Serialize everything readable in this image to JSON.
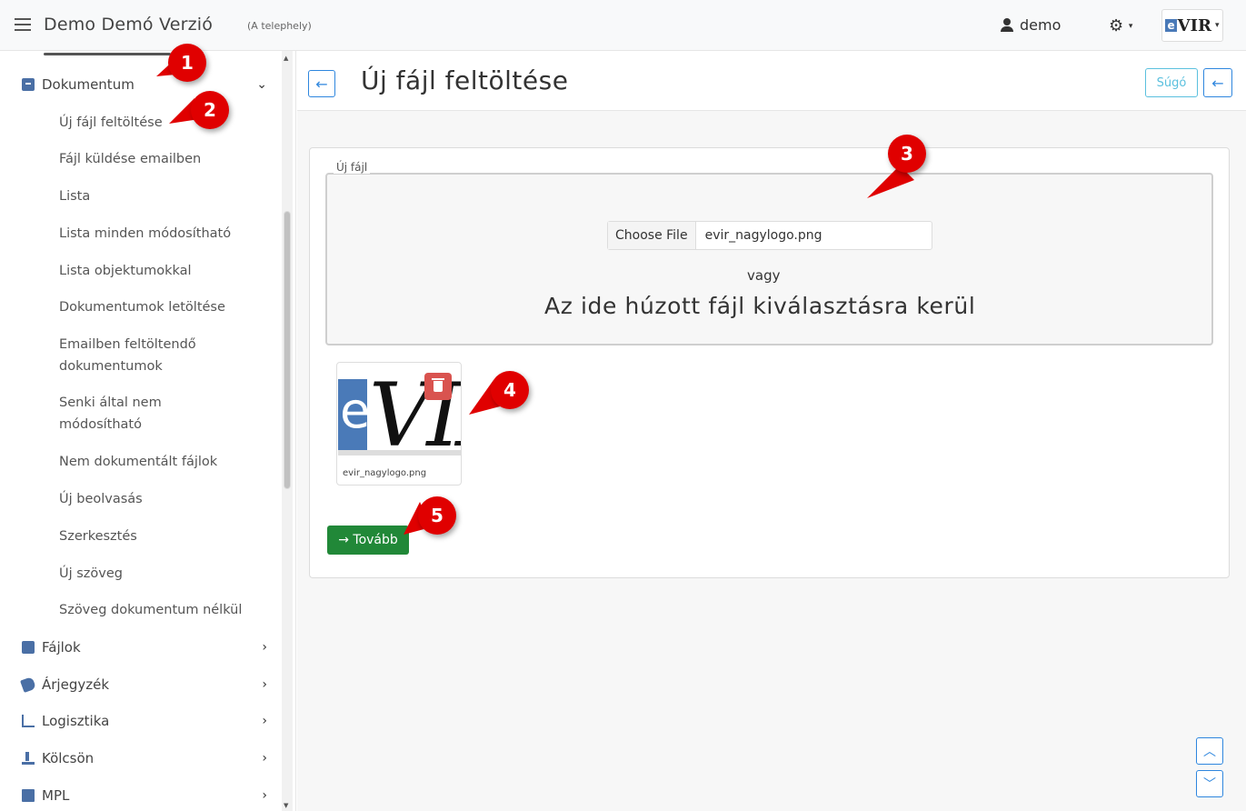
{
  "topbar": {
    "title": "Demo Demó Verzió",
    "subtitle": "(A telephely)",
    "user": "demo",
    "gear_icon": "gear-icon",
    "logo": "eVIR"
  },
  "sidebar": {
    "section": "Dokumentum",
    "sub_items": [
      "Új fájl feltöltése",
      "Fájl küldése emailben",
      "Lista",
      "Lista minden módosítható",
      "Lista objektumokkal",
      "Dokumentumok letöltése",
      "Emailben feltöltendő dokumentumok",
      "Senki által nem módosítható",
      "Nem dokumentált fájlok",
      "Új beolvasás",
      "Szerkesztés",
      "Új szöveg",
      "Szöveg dokumentum nélkül"
    ],
    "items": [
      "Fájlok",
      "Árjegyzék",
      "Logisztika",
      "Kölcsön",
      "MPL"
    ]
  },
  "header": {
    "title": "Új fájl feltöltése",
    "help": "Súgó"
  },
  "upload": {
    "legend": "Új fájl",
    "choose": "Choose File",
    "file_name": "evir_nagylogo.png",
    "or": "vagy",
    "drop": "Az ide húzott fájl kiválasztásra kerül",
    "thumb_name": "evir_nagylogo.png",
    "next": "→ Tovább"
  },
  "callouts": [
    "1",
    "2",
    "3",
    "4",
    "5"
  ],
  "colors": {
    "accent": "#2e86de",
    "danger": "#d9534f",
    "success": "#218838",
    "callout": "#e00000"
  }
}
